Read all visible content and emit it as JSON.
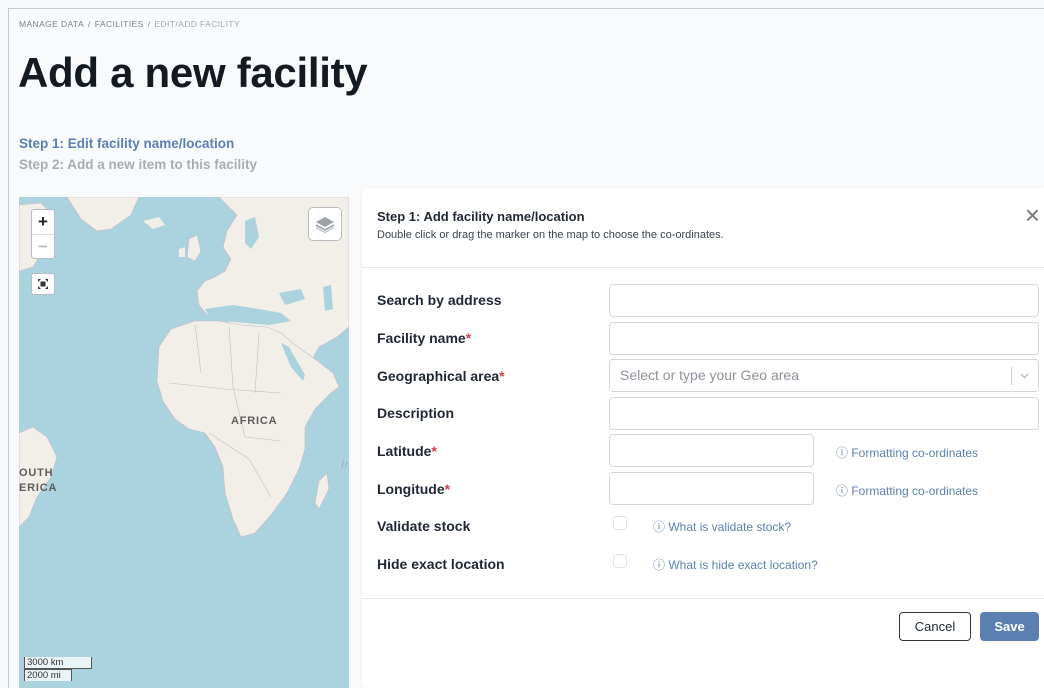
{
  "breadcrumb": [
    "MANAGE DATA",
    "FACILITIES",
    "EDIT/ADD FACILITY"
  ],
  "page": {
    "title": "Add a new facility",
    "step1": "Step 1: Edit facility name/location",
    "step2": "Step 2: Add a new item to this facility"
  },
  "map": {
    "zoom_in": "+",
    "zoom_out": "−",
    "labels": {
      "africa": "AFRICA",
      "south_1": "OUTH",
      "south_2": "ERICA",
      "indian": "In"
    },
    "scale_km": "3000 km",
    "scale_mi": "2000 mi",
    "colors": {
      "water": "#aad3df",
      "land": "#f2efe9",
      "border": "#c8b8c8"
    }
  },
  "panel": {
    "title": "Step 1: Add facility name/location",
    "subtitle": "Double click or drag the marker on the map to choose the co-ordinates.",
    "fields": {
      "search_label": "Search by address",
      "facility_label": "Facility name",
      "geo_label": "Geographical area",
      "geo_placeholder": "Select or type your Geo area",
      "description_label": "Description",
      "latitude_label": "Latitude",
      "longitude_label": "Longitude",
      "validate_label": "Validate stock",
      "hide_label": "Hide exact location",
      "required_mark": "*"
    },
    "hints": {
      "lat_hint": "ⓘ Formatting co-ordinates",
      "lon_hint": "ⓘ Formatting co-ordinates",
      "validate_hint": "ⓘ What is validate stock?",
      "hide_hint": "ⓘ What is hide exact location?"
    },
    "buttons": {
      "cancel": "Cancel",
      "save": "Save"
    },
    "accent": "#5b7fb1",
    "required_color": "#d13f4b"
  }
}
